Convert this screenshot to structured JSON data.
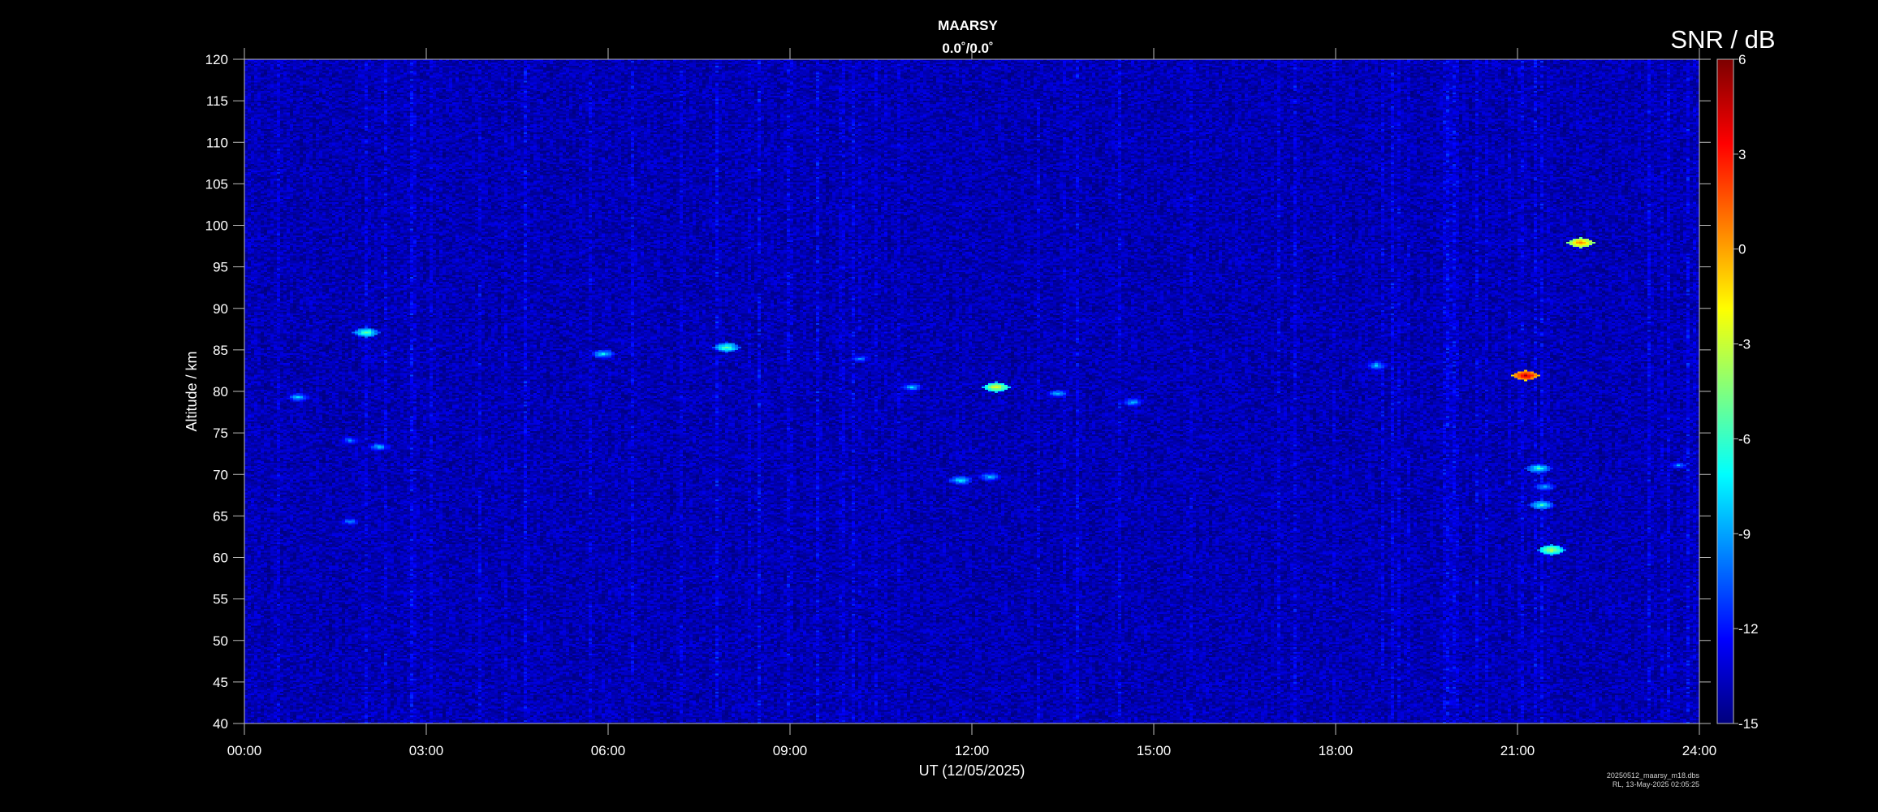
{
  "chart_data": {
    "type": "heatmap",
    "title": "MAARSY",
    "subtitle": "0.0˚/0.0˚",
    "xlabel": "UT (12/05/2025)",
    "ylabel": "Altitude / km",
    "xlim": [
      0,
      24
    ],
    "ylim": [
      40,
      120
    ],
    "x_ticks": [
      "00:00",
      "03:00",
      "06:00",
      "09:00",
      "12:00",
      "15:00",
      "18:00",
      "21:00",
      "24:00"
    ],
    "y_ticks": [
      40,
      45,
      50,
      55,
      60,
      65,
      70,
      75,
      80,
      85,
      90,
      95,
      100,
      105,
      110,
      115,
      120
    ],
    "colorbar": {
      "label": "SNR / dB",
      "range": [
        -15,
        6
      ],
      "ticks": [
        6,
        3,
        0,
        -3,
        -6,
        -9,
        -12,
        -15
      ],
      "colormap": "jet"
    },
    "background_snr_db": -14,
    "echo_regions": [
      {
        "t_hours": 0.85,
        "alt_km": 79.5,
        "snr_db": -8
      },
      {
        "t_hours": 2.0,
        "alt_km": 87.2,
        "snr_db": -5
      },
      {
        "t_hours": 1.7,
        "alt_km": 74.3,
        "snr_db": -9
      },
      {
        "t_hours": 2.2,
        "alt_km": 73.4,
        "snr_db": -8
      },
      {
        "t_hours": 1.7,
        "alt_km": 64.4,
        "snr_db": -9
      },
      {
        "t_hours": 5.9,
        "alt_km": 84.6,
        "snr_db": -7
      },
      {
        "t_hours": 7.95,
        "alt_km": 85.5,
        "snr_db": -5
      },
      {
        "t_hours": 10.1,
        "alt_km": 84.1,
        "snr_db": -9
      },
      {
        "t_hours": 11.0,
        "alt_km": 80.6,
        "snr_db": -8
      },
      {
        "t_hours": 12.35,
        "alt_km": 80.6,
        "snr_db": -2
      },
      {
        "t_hours": 13.4,
        "alt_km": 79.8,
        "snr_db": -8
      },
      {
        "t_hours": 14.65,
        "alt_km": 78.8,
        "snr_db": -8
      },
      {
        "t_hours": 11.8,
        "alt_km": 69.4,
        "snr_db": -7
      },
      {
        "t_hours": 12.25,
        "alt_km": 69.8,
        "snr_db": -8
      },
      {
        "t_hours": 18.65,
        "alt_km": 83.2,
        "snr_db": -8
      },
      {
        "t_hours": 21.1,
        "alt_km": 82.0,
        "snr_db": 5
      },
      {
        "t_hours": 21.3,
        "alt_km": 70.8,
        "snr_db": -6
      },
      {
        "t_hours": 21.45,
        "alt_km": 68.6,
        "snr_db": -8
      },
      {
        "t_hours": 21.4,
        "alt_km": 66.4,
        "snr_db": -6
      },
      {
        "t_hours": 21.55,
        "alt_km": 61.0,
        "snr_db": -3
      },
      {
        "t_hours": 22.0,
        "alt_km": 98.0,
        "snr_db": 1
      },
      {
        "t_hours": 23.6,
        "alt_km": 71.2,
        "snr_db": -9
      }
    ]
  },
  "footer": {
    "line1": "20250512_maarsy_m18.dbs",
    "line2": "RL, 13-May-2025 02:05:25"
  }
}
